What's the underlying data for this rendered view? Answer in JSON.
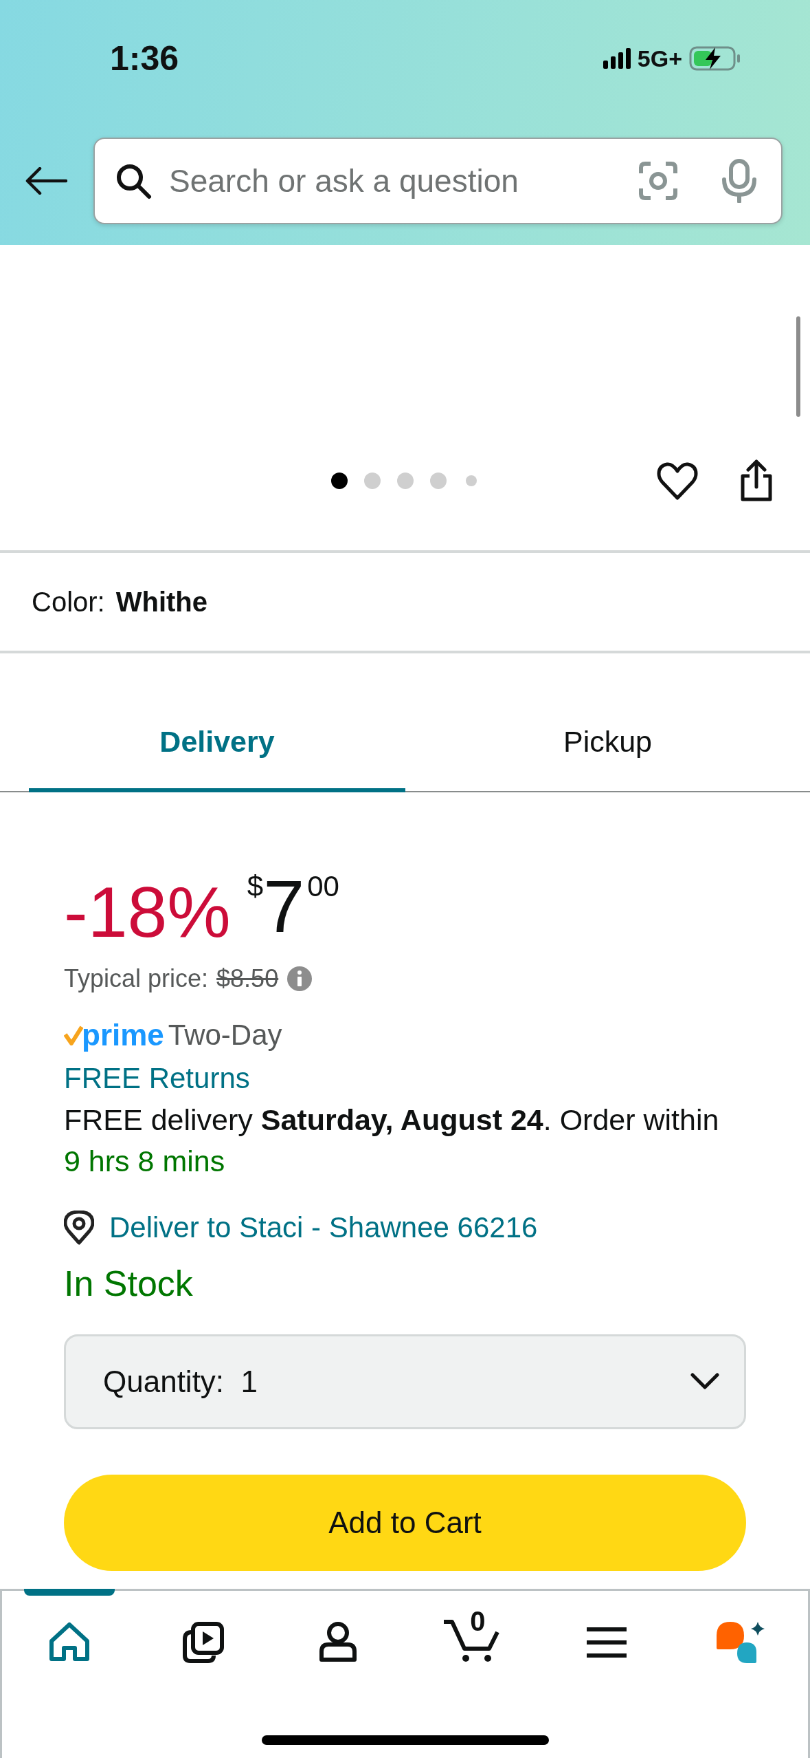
{
  "status_bar": {
    "time": "1:36",
    "network": "5G+"
  },
  "search": {
    "placeholder": "Search or ask a question"
  },
  "carousel": {
    "dots": [
      {
        "selected": true
      },
      {
        "selected": false
      },
      {
        "selected": false
      },
      {
        "selected": false
      },
      {
        "selected": false
      }
    ]
  },
  "color": {
    "label": "Color:",
    "value": "Whithe"
  },
  "tabs": [
    {
      "label": "Delivery",
      "selected": true
    },
    {
      "label": "Pickup",
      "selected": false
    }
  ],
  "price": {
    "discount": "-18%",
    "currency": "$",
    "whole": "7",
    "fraction": "00",
    "typical_label": "Typical price:",
    "typical_value": "$8.50"
  },
  "prime": {
    "logo": "prime",
    "speed": "Two-Day"
  },
  "returns": "FREE Returns",
  "delivery": "FREE delivery **Saturday, August 24**. Order within",
  "countdown": "9 hrs 8 mins",
  "deliver_to": "Deliver to Staci - Shawnee 66216",
  "stock": "In Stock",
  "quantity": {
    "label": "Quantity:",
    "value": "1"
  },
  "add_to_cart": "Add to Cart",
  "nav": [
    {
      "kind": "home",
      "selected": true
    },
    {
      "kind": "video",
      "selected": false
    },
    {
      "kind": "account",
      "selected": false
    },
    {
      "kind": "cart",
      "selected": false,
      "count": "0"
    },
    {
      "kind": "menu",
      "selected": false
    },
    {
      "kind": "assistant",
      "selected": false
    }
  ]
}
